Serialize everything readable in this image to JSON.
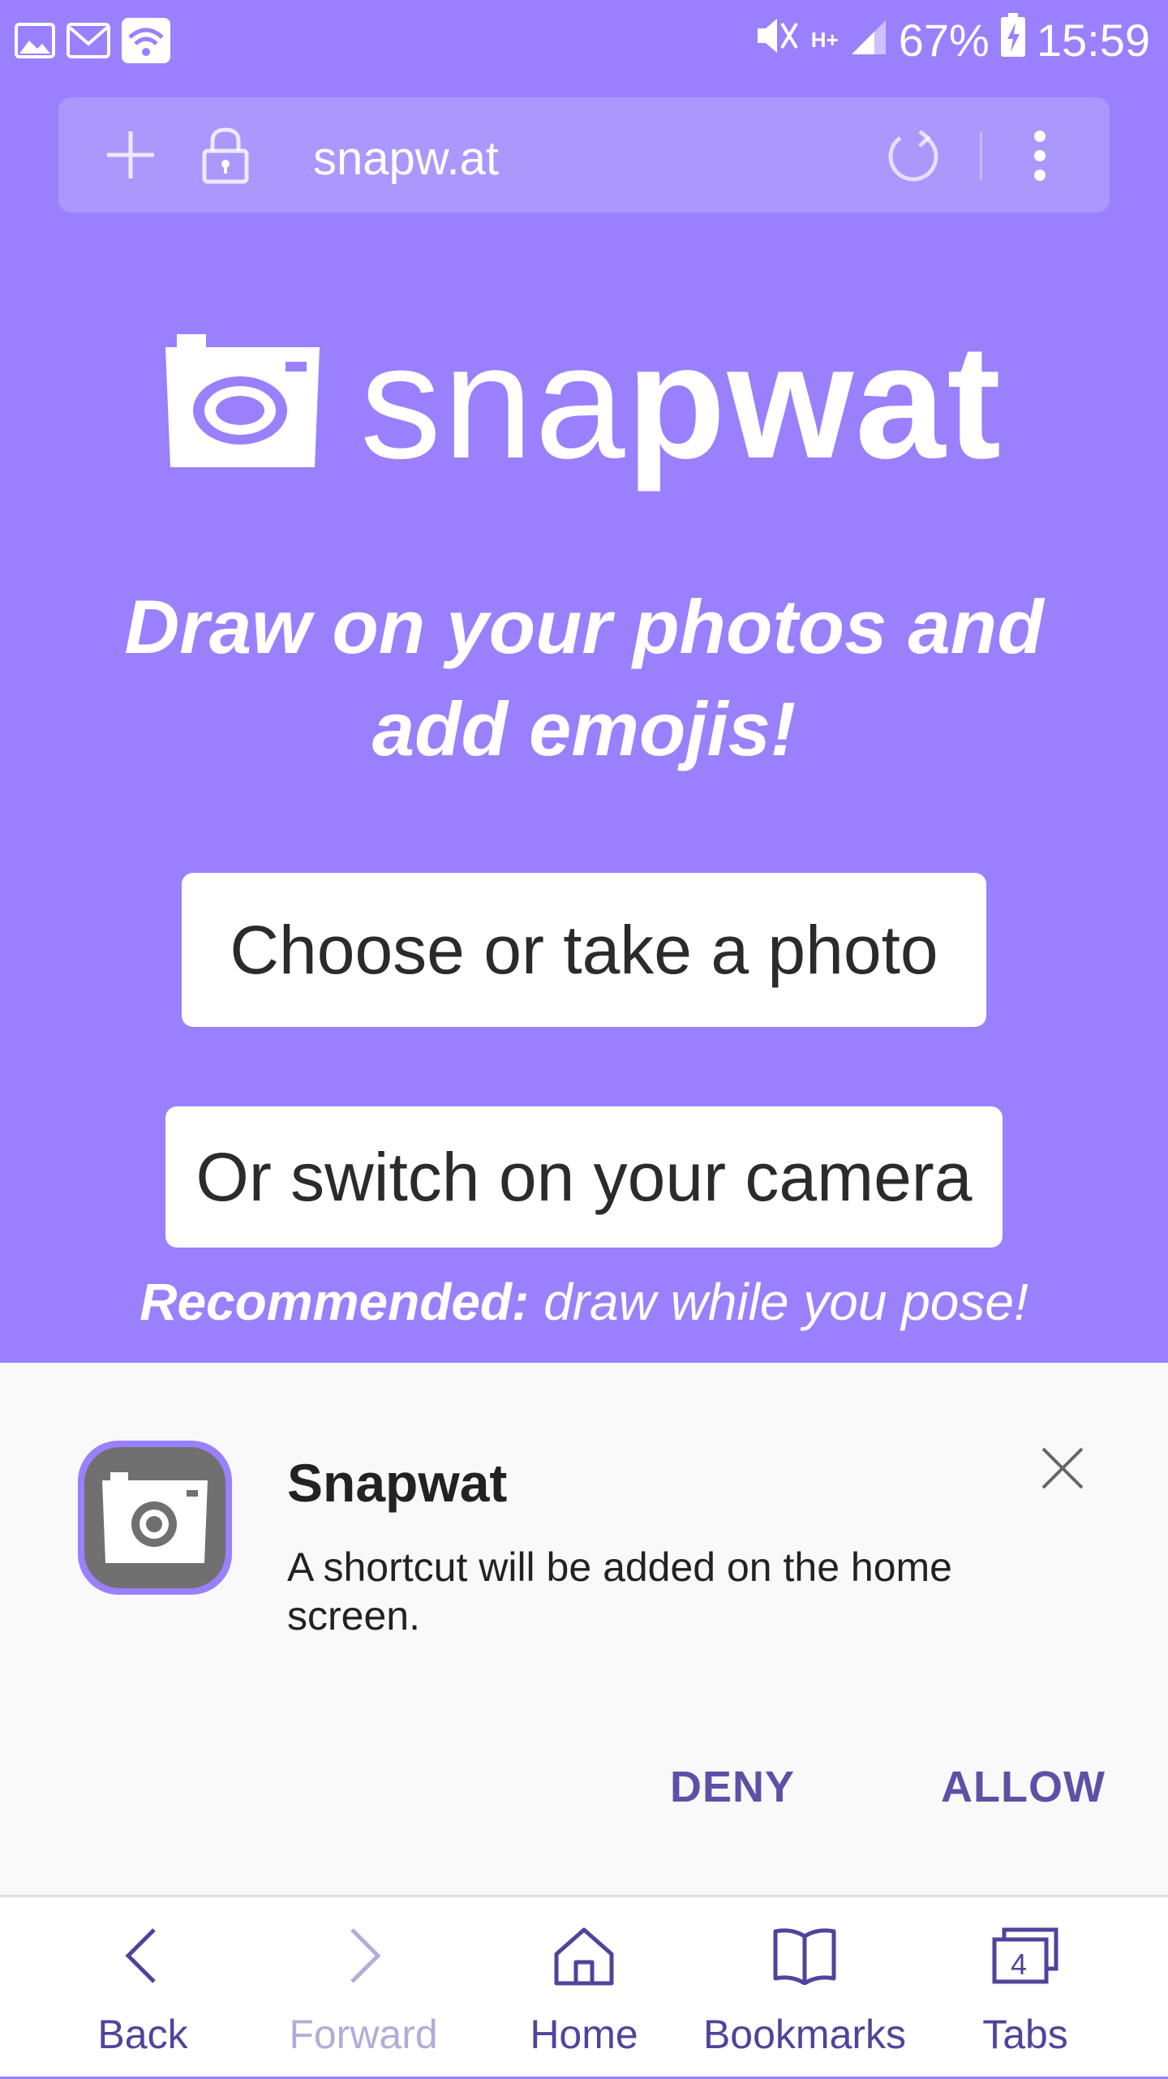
{
  "status_bar": {
    "battery": "67%",
    "time": "15:59",
    "network": "H+"
  },
  "browser": {
    "url": "snapw.at"
  },
  "page": {
    "logo_light": "sna",
    "logo_bold": "pwat",
    "tagline": "Draw on your photos and add emojis!",
    "choose_button": "Choose or take a photo",
    "camera_button": "Or switch on your camera",
    "recommend_bold": "Recommended:",
    "recommend_text": " draw while you pose!"
  },
  "dialog": {
    "title": "Snapwat",
    "message": "A shortcut will be added on the home screen.",
    "deny": "DENY",
    "allow": "ALLOW"
  },
  "bottom_nav": {
    "back": "Back",
    "forward": "Forward",
    "home": "Home",
    "bookmarks": "Bookmarks",
    "tabs": "Tabs",
    "tab_count": "4"
  },
  "colors": {
    "brand": "#9a80fd",
    "dialog_action": "#5b52a6",
    "nav_text": "#4f449c"
  }
}
